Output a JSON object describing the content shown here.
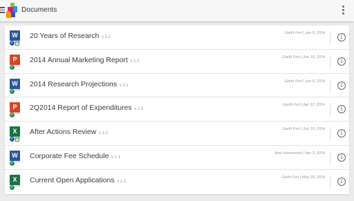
{
  "appbar": {
    "title": "Documents",
    "menu_icon": "hamburger-menu-icon",
    "logo_icon": "app-logo",
    "overflow_icon": "vertical-dots-icon"
  },
  "colors": {
    "word": "#2b579a",
    "powerpoint": "#d24726",
    "excel": "#1e7145",
    "sync_badge": "#1f5fa8",
    "ok_badge": "#2e8b57"
  },
  "info_glyph": "i",
  "documents": [
    {
      "name": "20 Years of Research",
      "version": "v 5.1",
      "meta": "Garth Fort | Jun 9, 2014",
      "type": "word",
      "letter": "W",
      "badge": "synced"
    },
    {
      "name": "2014 Annual Marketing Report",
      "version": "v 1.1",
      "meta": "Garth Fort | Jun 10, 2014",
      "type": "powerpoint",
      "letter": "P",
      "badge": "ok"
    },
    {
      "name": "2014 Research Projections",
      "version": "v 2.1",
      "meta": "Garth Fort | Jun 6, 2014",
      "type": "word",
      "letter": "W",
      "badge": "ok"
    },
    {
      "name": "2Q2014 Report of Expenditures",
      "version": "v 1.1",
      "meta": "Garth Fort | Apr 12, 2014",
      "type": "powerpoint",
      "letter": "P",
      "badge": "ok"
    },
    {
      "name": "After Actions Review",
      "version": "v 1.1",
      "meta": "Garth Fort | Jun 10, 2014",
      "type": "excel",
      "letter": "X",
      "badge": "synced"
    },
    {
      "name": "Corporate Fee Schedule",
      "version": "v 1.1",
      "meta": "Aziz Hassouneh | Apr 3, 2014",
      "type": "word",
      "letter": "W",
      "badge": "ok"
    },
    {
      "name": "Current Open Applications",
      "version": "v 1.1",
      "meta": "Garth Fort | May 20, 2014",
      "type": "excel",
      "letter": "X",
      "badge": "ok"
    }
  ]
}
